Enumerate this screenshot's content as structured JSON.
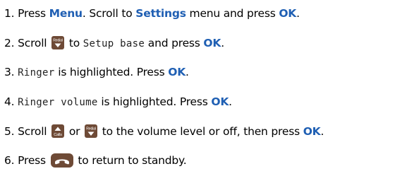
{
  "steps": [
    {
      "num": "1.",
      "parts": {
        "a": "Press ",
        "b": "Menu",
        "c": ". Scroll to ",
        "d": "Settings",
        "e": " menu and press ",
        "f": "OK",
        "g": "."
      }
    },
    {
      "num": "2.",
      "parts": {
        "a": "Scroll ",
        "b": " to ",
        "c": "Setup base",
        "d": " and press ",
        "e": "OK",
        "f": "."
      }
    },
    {
      "num": "3.",
      "parts": {
        "a": "Ringer",
        "b": " is highlighted. Press ",
        "c": "OK",
        "d": "."
      }
    },
    {
      "num": "4.",
      "parts": {
        "a": "Ringer volume",
        "b": " is highlighted. Press ",
        "c": "OK",
        "d": "."
      }
    },
    {
      "num": "5.",
      "parts": {
        "a": "Scroll ",
        "b": " or ",
        "c": " to the volume level or off, then press ",
        "d": "OK",
        "e": "."
      }
    },
    {
      "num": "6.",
      "parts": {
        "a": "Press ",
        "b": " to return to standby."
      }
    }
  ],
  "keys": {
    "redial_label": "Redial",
    "calls_label": "Calls"
  },
  "colors": {
    "keyword": "#1f5fb3",
    "key_background": "#6e4a36",
    "key_foreground": "#ffffff"
  },
  "icons": {
    "redial_down": "redial-down-key-icon",
    "calls_up": "calls-up-key-icon",
    "end_call": "end-call-key-icon"
  }
}
